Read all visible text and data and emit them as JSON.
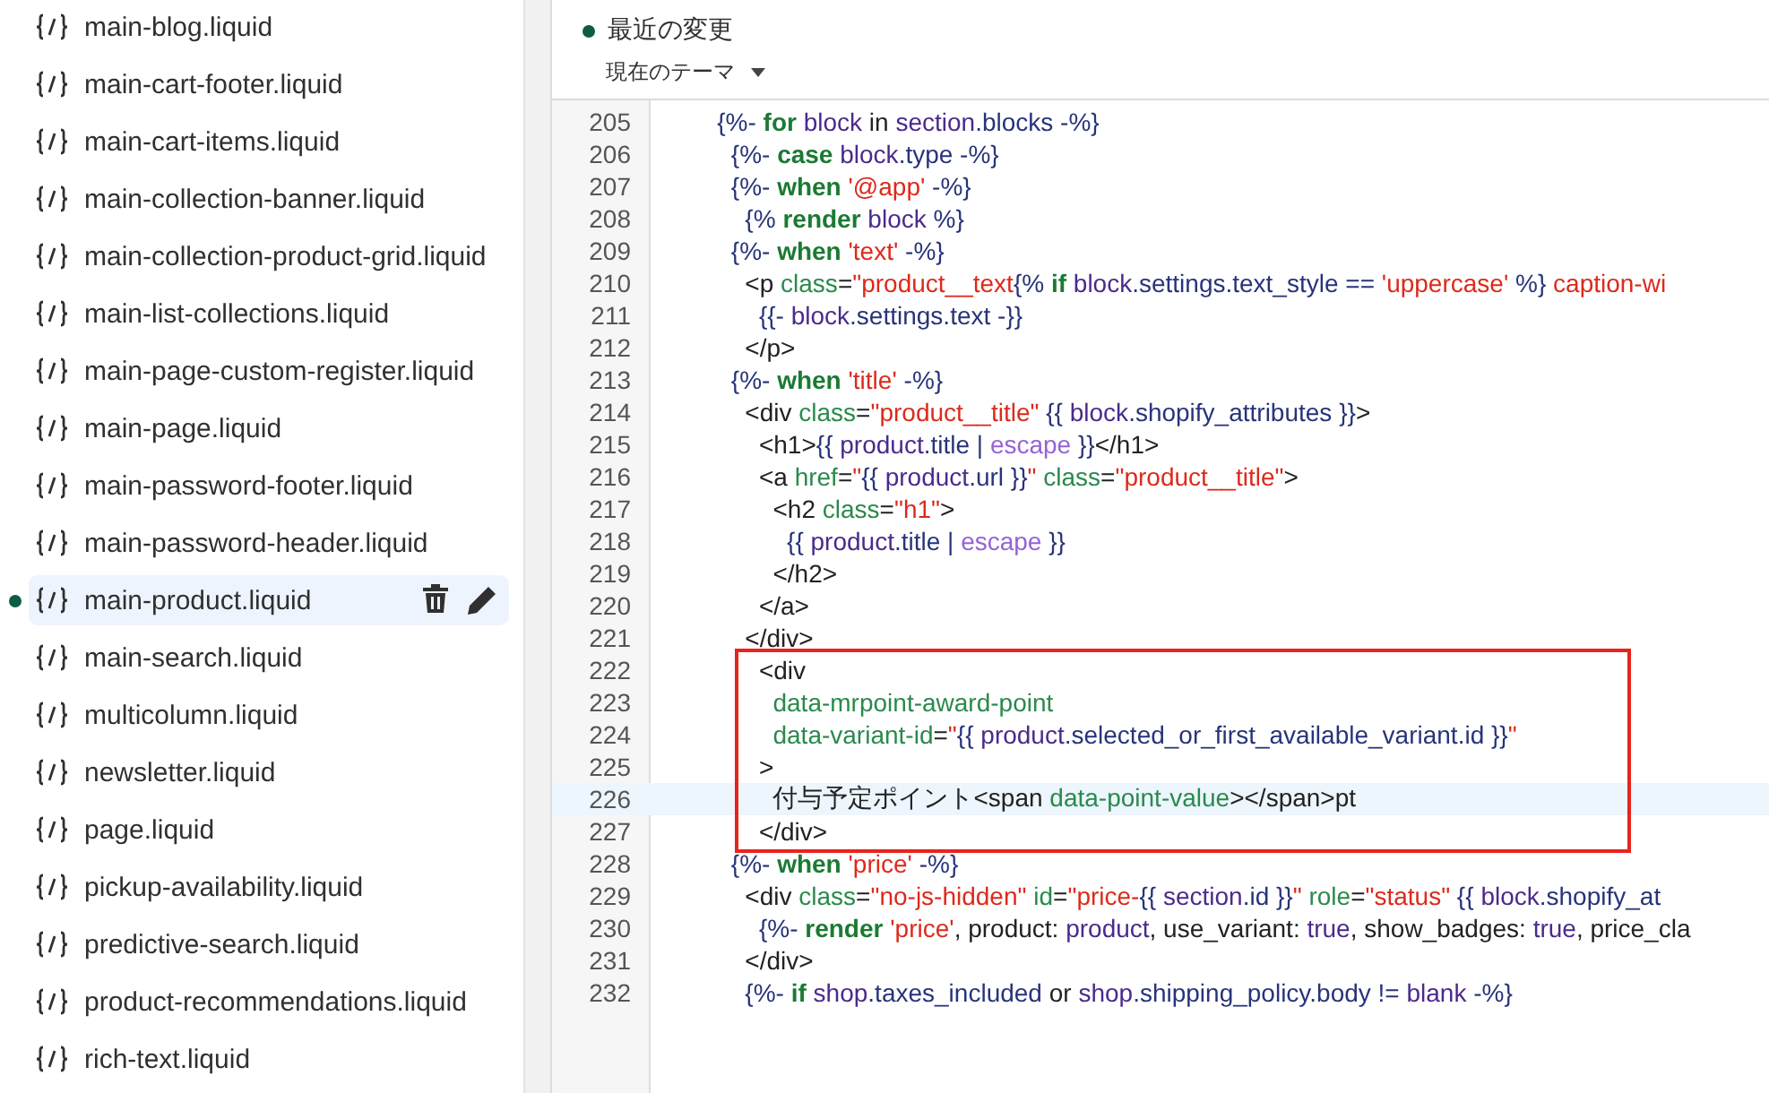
{
  "files": [
    {
      "name": "main-blog.liquid",
      "selected": false,
      "modified": false
    },
    {
      "name": "main-cart-footer.liquid",
      "selected": false,
      "modified": false
    },
    {
      "name": "main-cart-items.liquid",
      "selected": false,
      "modified": false
    },
    {
      "name": "main-collection-banner.liquid",
      "selected": false,
      "modified": false
    },
    {
      "name": "main-collection-product-grid.liquid",
      "selected": false,
      "modified": false
    },
    {
      "name": "main-list-collections.liquid",
      "selected": false,
      "modified": false
    },
    {
      "name": "main-page-custom-register.liquid",
      "selected": false,
      "modified": false
    },
    {
      "name": "main-page.liquid",
      "selected": false,
      "modified": false
    },
    {
      "name": "main-password-footer.liquid",
      "selected": false,
      "modified": false
    },
    {
      "name": "main-password-header.liquid",
      "selected": false,
      "modified": false
    },
    {
      "name": "main-product.liquid",
      "selected": true,
      "modified": true
    },
    {
      "name": "main-search.liquid",
      "selected": false,
      "modified": false
    },
    {
      "name": "multicolumn.liquid",
      "selected": false,
      "modified": false
    },
    {
      "name": "newsletter.liquid",
      "selected": false,
      "modified": false
    },
    {
      "name": "page.liquid",
      "selected": false,
      "modified": false
    },
    {
      "name": "pickup-availability.liquid",
      "selected": false,
      "modified": false
    },
    {
      "name": "predictive-search.liquid",
      "selected": false,
      "modified": false
    },
    {
      "name": "product-recommendations.liquid",
      "selected": false,
      "modified": false
    },
    {
      "name": "rich-text.liquid",
      "selected": false,
      "modified": false
    }
  ],
  "editor": {
    "recent_changes": "最近の変更",
    "theme_select": "現在のテーマ",
    "lines": [
      {
        "number": "205",
        "current": false,
        "boxed": false,
        "tokens": [
          {
            "kind": "delim",
            "text": "        {%- "
          },
          {
            "kind": "keyword",
            "text": "for"
          },
          {
            "kind": "var",
            "text": " block"
          },
          {
            "kind": "plain",
            "text": " in "
          },
          {
            "kind": "var",
            "text": "section"
          },
          {
            "kind": "delim",
            "text": ".blocks -%}"
          }
        ]
      },
      {
        "number": "206",
        "current": false,
        "boxed": false,
        "tokens": [
          {
            "kind": "delim",
            "text": "          {%- "
          },
          {
            "kind": "keyword",
            "text": "case"
          },
          {
            "kind": "var",
            "text": " block"
          },
          {
            "kind": "delim",
            "text": ".type -%}"
          }
        ]
      },
      {
        "number": "207",
        "current": false,
        "boxed": false,
        "tokens": [
          {
            "kind": "delim",
            "text": "          {%- "
          },
          {
            "kind": "keyword",
            "text": "when"
          },
          {
            "kind": "string",
            "text": " '@app'"
          },
          {
            "kind": "delim",
            "text": " -%}"
          }
        ]
      },
      {
        "number": "208",
        "current": false,
        "boxed": false,
        "tokens": [
          {
            "kind": "delim",
            "text": "            {% "
          },
          {
            "kind": "keyword",
            "text": "render"
          },
          {
            "kind": "var",
            "text": " block"
          },
          {
            "kind": "delim",
            "text": " %}"
          }
        ]
      },
      {
        "number": "209",
        "current": false,
        "boxed": false,
        "tokens": [
          {
            "kind": "delim",
            "text": "          {%- "
          },
          {
            "kind": "keyword",
            "text": "when"
          },
          {
            "kind": "string",
            "text": " 'text'"
          },
          {
            "kind": "delim",
            "text": " -%}"
          }
        ]
      },
      {
        "number": "210",
        "current": false,
        "boxed": false,
        "tokens": [
          {
            "kind": "plain",
            "text": "            <p "
          },
          {
            "kind": "attr",
            "text": "class"
          },
          {
            "kind": "plain",
            "text": "="
          },
          {
            "kind": "string",
            "text": "\"product__text"
          },
          {
            "kind": "delim",
            "text": "{% "
          },
          {
            "kind": "keyword",
            "text": "if"
          },
          {
            "kind": "var",
            "text": " block"
          },
          {
            "kind": "delim",
            "text": ".settings.text_style == "
          },
          {
            "kind": "string",
            "text": "'uppercase'"
          },
          {
            "kind": "delim",
            "text": " %}"
          },
          {
            "kind": "string",
            "text": " caption-wi"
          }
        ]
      },
      {
        "number": "211",
        "current": false,
        "boxed": false,
        "tokens": [
          {
            "kind": "delim",
            "text": "              {{- "
          },
          {
            "kind": "var",
            "text": "block"
          },
          {
            "kind": "delim",
            "text": ".settings.text -}}"
          }
        ]
      },
      {
        "number": "212",
        "current": false,
        "boxed": false,
        "tokens": [
          {
            "kind": "plain",
            "text": "            </p>"
          }
        ]
      },
      {
        "number": "213",
        "current": false,
        "boxed": false,
        "tokens": [
          {
            "kind": "delim",
            "text": "          {%- "
          },
          {
            "kind": "keyword",
            "text": "when"
          },
          {
            "kind": "string",
            "text": " 'title'"
          },
          {
            "kind": "delim",
            "text": " -%}"
          }
        ]
      },
      {
        "number": "214",
        "current": false,
        "boxed": false,
        "tokens": [
          {
            "kind": "plain",
            "text": "            <div "
          },
          {
            "kind": "attr",
            "text": "class"
          },
          {
            "kind": "plain",
            "text": "="
          },
          {
            "kind": "string",
            "text": "\"product__title\""
          },
          {
            "kind": "delim",
            "text": " {{ "
          },
          {
            "kind": "var",
            "text": "block"
          },
          {
            "kind": "delim",
            "text": ".shopify_attributes }}"
          },
          {
            "kind": "plain",
            "text": ">"
          }
        ]
      },
      {
        "number": "215",
        "current": false,
        "boxed": false,
        "tokens": [
          {
            "kind": "plain",
            "text": "              <h1>"
          },
          {
            "kind": "delim",
            "text": "{{ "
          },
          {
            "kind": "var",
            "text": "product"
          },
          {
            "kind": "delim",
            "text": ".title | "
          },
          {
            "kind": "filter",
            "text": "escape"
          },
          {
            "kind": "delim",
            "text": " }}"
          },
          {
            "kind": "plain",
            "text": "</h1>"
          }
        ]
      },
      {
        "number": "216",
        "current": false,
        "boxed": false,
        "tokens": [
          {
            "kind": "plain",
            "text": "              <a "
          },
          {
            "kind": "attr",
            "text": "href"
          },
          {
            "kind": "plain",
            "text": "="
          },
          {
            "kind": "string",
            "text": "\""
          },
          {
            "kind": "delim",
            "text": "{{ "
          },
          {
            "kind": "var",
            "text": "product"
          },
          {
            "kind": "delim",
            "text": ".url }}"
          },
          {
            "kind": "string",
            "text": "\""
          },
          {
            "kind": "attr",
            "text": " class"
          },
          {
            "kind": "plain",
            "text": "="
          },
          {
            "kind": "string",
            "text": "\"product__title\""
          },
          {
            "kind": "plain",
            "text": ">"
          }
        ]
      },
      {
        "number": "217",
        "current": false,
        "boxed": false,
        "tokens": [
          {
            "kind": "plain",
            "text": "                <h2 "
          },
          {
            "kind": "attr",
            "text": "class"
          },
          {
            "kind": "plain",
            "text": "="
          },
          {
            "kind": "string",
            "text": "\"h1\""
          },
          {
            "kind": "plain",
            "text": ">"
          }
        ]
      },
      {
        "number": "218",
        "current": false,
        "boxed": false,
        "tokens": [
          {
            "kind": "delim",
            "text": "                  {{ "
          },
          {
            "kind": "var",
            "text": "product"
          },
          {
            "kind": "delim",
            "text": ".title | "
          },
          {
            "kind": "filter",
            "text": "escape"
          },
          {
            "kind": "delim",
            "text": " }}"
          }
        ]
      },
      {
        "number": "219",
        "current": false,
        "boxed": false,
        "tokens": [
          {
            "kind": "plain",
            "text": "                </h2>"
          }
        ]
      },
      {
        "number": "220",
        "current": false,
        "boxed": false,
        "tokens": [
          {
            "kind": "plain",
            "text": "              </a>"
          }
        ]
      },
      {
        "number": "221",
        "current": false,
        "boxed": false,
        "tokens": [
          {
            "kind": "plain",
            "text": "            </div>"
          }
        ]
      },
      {
        "number": "222",
        "current": false,
        "boxed": true,
        "tokens": [
          {
            "kind": "plain",
            "text": "              <div"
          }
        ]
      },
      {
        "number": "223",
        "current": false,
        "boxed": true,
        "tokens": [
          {
            "kind": "attr",
            "text": "                data-mrpoint-award-point"
          }
        ]
      },
      {
        "number": "224",
        "current": false,
        "boxed": true,
        "tokens": [
          {
            "kind": "attr",
            "text": "                data-variant-id"
          },
          {
            "kind": "plain",
            "text": "="
          },
          {
            "kind": "string",
            "text": "\""
          },
          {
            "kind": "delim",
            "text": "{{ "
          },
          {
            "kind": "var",
            "text": "product"
          },
          {
            "kind": "delim",
            "text": ".selected_or_first_available_variant.id }}"
          },
          {
            "kind": "string",
            "text": "\""
          }
        ]
      },
      {
        "number": "225",
        "current": false,
        "boxed": true,
        "tokens": [
          {
            "kind": "plain",
            "text": "              >"
          }
        ]
      },
      {
        "number": "226",
        "current": true,
        "boxed": true,
        "tokens": [
          {
            "kind": "plain",
            "text": "                付与予定ポイント<span "
          },
          {
            "kind": "attr",
            "text": "data-point-value"
          },
          {
            "kind": "plain",
            "text": "></span>pt"
          }
        ]
      },
      {
        "number": "227",
        "current": false,
        "boxed": true,
        "tokens": [
          {
            "kind": "plain",
            "text": "              </div>"
          }
        ]
      },
      {
        "number": "228",
        "current": false,
        "boxed": false,
        "tokens": [
          {
            "kind": "delim",
            "text": "          {%- "
          },
          {
            "kind": "keyword",
            "text": "when"
          },
          {
            "kind": "string",
            "text": " 'price'"
          },
          {
            "kind": "delim",
            "text": " -%}"
          }
        ]
      },
      {
        "number": "229",
        "current": false,
        "boxed": false,
        "tokens": [
          {
            "kind": "plain",
            "text": "            <div "
          },
          {
            "kind": "attr",
            "text": "class"
          },
          {
            "kind": "plain",
            "text": "="
          },
          {
            "kind": "string",
            "text": "\"no-js-hidden\""
          },
          {
            "kind": "attr",
            "text": " id"
          },
          {
            "kind": "plain",
            "text": "="
          },
          {
            "kind": "string",
            "text": "\"price-"
          },
          {
            "kind": "delim",
            "text": "{{ "
          },
          {
            "kind": "var",
            "text": "section"
          },
          {
            "kind": "delim",
            "text": ".id }}"
          },
          {
            "kind": "string",
            "text": "\""
          },
          {
            "kind": "attr",
            "text": " role"
          },
          {
            "kind": "plain",
            "text": "="
          },
          {
            "kind": "string",
            "text": "\"status\""
          },
          {
            "kind": "delim",
            "text": " {{ "
          },
          {
            "kind": "var",
            "text": "block"
          },
          {
            "kind": "delim",
            "text": ".shopify_at"
          }
        ]
      },
      {
        "number": "230",
        "current": false,
        "boxed": false,
        "tokens": [
          {
            "kind": "delim",
            "text": "              {%- "
          },
          {
            "kind": "keyword",
            "text": "render"
          },
          {
            "kind": "string",
            "text": " 'price'"
          },
          {
            "kind": "plain",
            "text": ", product: "
          },
          {
            "kind": "var",
            "text": "product"
          },
          {
            "kind": "plain",
            "text": ", use_variant: "
          },
          {
            "kind": "var",
            "text": "true"
          },
          {
            "kind": "plain",
            "text": ", show_badges: "
          },
          {
            "kind": "var",
            "text": "true"
          },
          {
            "kind": "plain",
            "text": ", price_cla"
          }
        ]
      },
      {
        "number": "231",
        "current": false,
        "boxed": false,
        "tokens": [
          {
            "kind": "plain",
            "text": "            </div>"
          }
        ]
      },
      {
        "number": "232",
        "current": false,
        "boxed": false,
        "tokens": [
          {
            "kind": "delim",
            "text": "            {%- "
          },
          {
            "kind": "keyword",
            "text": "if"
          },
          {
            "kind": "var",
            "text": " shop"
          },
          {
            "kind": "delim",
            "text": ".taxes_included "
          },
          {
            "kind": "plain",
            "text": "or "
          },
          {
            "kind": "var",
            "text": "shop"
          },
          {
            "kind": "delim",
            "text": ".shipping_policy.body != "
          },
          {
            "kind": "var",
            "text": "blank"
          },
          {
            "kind": "delim",
            "text": " -%}"
          }
        ]
      }
    ]
  }
}
